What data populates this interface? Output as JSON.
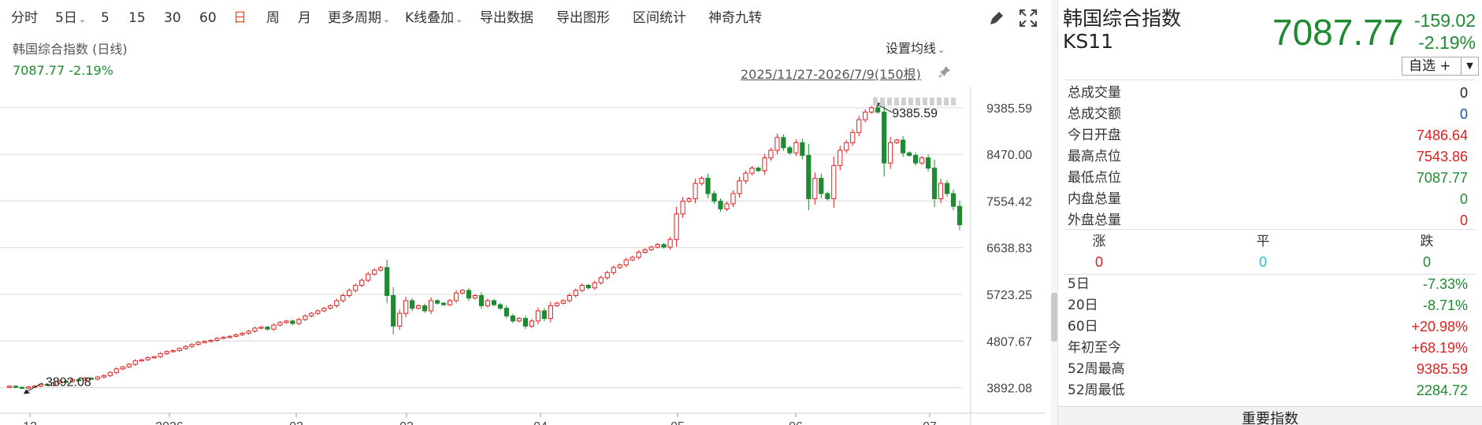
{
  "toolbar": {
    "items": [
      {
        "label": "分时",
        "dropdown": false,
        "active": false
      },
      {
        "label": "5日",
        "dropdown": true,
        "active": false
      },
      {
        "label": "5",
        "dropdown": false,
        "active": false
      },
      {
        "label": "15",
        "dropdown": false,
        "active": false
      },
      {
        "label": "30",
        "dropdown": false,
        "active": false
      },
      {
        "label": "60",
        "dropdown": false,
        "active": false
      },
      {
        "label": "日",
        "dropdown": false,
        "active": true
      },
      {
        "label": "周",
        "dropdown": false,
        "active": false
      },
      {
        "label": "月",
        "dropdown": false,
        "active": false
      },
      {
        "label": "更多周期",
        "dropdown": true,
        "active": false
      },
      {
        "label": "K线叠加",
        "dropdown": true,
        "active": false
      },
      {
        "label": "导出数据",
        "dropdown": false,
        "active": false
      },
      {
        "label": "导出图形",
        "dropdown": false,
        "active": false
      },
      {
        "label": "区间统计",
        "dropdown": false,
        "active": false
      },
      {
        "label": "神奇九转",
        "dropdown": false,
        "active": false
      }
    ],
    "icons": [
      "brush-icon",
      "fullscreen-icon"
    ],
    "caret": "⌄"
  },
  "chart_header": {
    "index_label": "韩国综合指数 (日线)",
    "value_line": "7087.77 -2.19%",
    "ma_setting": "设置均线",
    "date_range": "2025/11/27-2026/7/9(150根)"
  },
  "chart_data": {
    "type": "candlestick",
    "period": "daily",
    "ylim": [
      3700,
      9800
    ],
    "y_ticks": [
      "9385.59",
      "8470.00",
      "7554.42",
      "6638.83",
      "5723.25",
      "4807.67",
      "3892.08"
    ],
    "x_ticks": [
      "12",
      "2026",
      "02",
      "03",
      "04",
      "05",
      "06",
      "07"
    ],
    "annotations": [
      {
        "text": "9385.59",
        "kind": "high"
      },
      {
        "text": "3892.08",
        "kind": "low"
      }
    ],
    "colors": {
      "up": "#e02020",
      "down": "#1e8b32",
      "grid": "#d9d9d9"
    },
    "closes": [
      3920,
      3900,
      3892,
      3905,
      3925,
      3960,
      3940,
      3985,
      4020,
      4010,
      4050,
      4040,
      4080,
      4060,
      4100,
      4130,
      4190,
      4260,
      4300,
      4350,
      4420,
      4440,
      4480,
      4500,
      4560,
      4600,
      4620,
      4660,
      4700,
      4740,
      4780,
      4800,
      4820,
      4860,
      4880,
      4900,
      4930,
      4960,
      5000,
      5060,
      5080,
      5040,
      5120,
      5170,
      5200,
      5150,
      5230,
      5300,
      5350,
      5400,
      5450,
      5500,
      5600,
      5700,
      5800,
      5900,
      6000,
      6120,
      6200,
      6250,
      5700,
      5100,
      5350,
      5600,
      5450,
      5500,
      5400,
      5600,
      5550,
      5520,
      5600,
      5750,
      5800,
      5650,
      5700,
      5500,
      5600,
      5520,
      5450,
      5300,
      5200,
      5250,
      5100,
      5200,
      5400,
      5250,
      5500,
      5550,
      5600,
      5700,
      5800,
      5900,
      5850,
      5950,
      6050,
      6150,
      6250,
      6300,
      6400,
      6450,
      6550,
      6600,
      6650,
      6700,
      6650,
      6800,
      7300,
      7550,
      7600,
      7900,
      8000,
      7700,
      7550,
      7400,
      7500,
      7700,
      7950,
      8100,
      8200,
      8150,
      8400,
      8550,
      8800,
      8600,
      8500,
      8700,
      8450,
      7600,
      8000,
      7700,
      7600,
      8250,
      8550,
      8700,
      8900,
      9150,
      9300,
      9385,
      9300,
      8300,
      8700,
      8750,
      8500,
      8450,
      8300,
      8400,
      8200,
      7600,
      7900,
      7700,
      7450,
      7087.77
    ]
  },
  "quote": {
    "name": "韩国综合指数",
    "code": "KS11",
    "price": "7087.77",
    "change": "-159.02",
    "change_pct": "-2.19%",
    "watch_label": "自选 +",
    "watch_arrow": "▼",
    "stats": [
      {
        "label": "总成交量",
        "value": "0",
        "color": "#222222"
      },
      {
        "label": "总成交额",
        "value": "0",
        "color": "#1f4fa8"
      },
      {
        "label": "今日开盘",
        "value": "7486.64",
        "color": "#e02020"
      },
      {
        "label": "最高点位",
        "value": "7543.86",
        "color": "#e02020"
      },
      {
        "label": "最低点位",
        "value": "7087.77",
        "color": "#1e8b32"
      },
      {
        "label": "内盘总量",
        "value": "0",
        "color": "#1e8b32"
      },
      {
        "label": "外盘总量",
        "value": "0",
        "color": "#e02020"
      }
    ],
    "advance": [
      {
        "label": "涨",
        "value": "0",
        "color": "#e02020"
      },
      {
        "label": "平",
        "value": "0",
        "color": "#1ec8d8"
      },
      {
        "label": "跌",
        "value": "0",
        "color": "#1e8b32"
      }
    ],
    "performance": [
      {
        "label": "5日",
        "value": "-7.33%",
        "color": "#1e8b32"
      },
      {
        "label": "20日",
        "value": "-8.71%",
        "color": "#1e8b32"
      },
      {
        "label": "60日",
        "value": "+20.98%",
        "color": "#e02020"
      },
      {
        "label": "年初至今",
        "value": "+68.19%",
        "color": "#e02020"
      },
      {
        "label": "52周最高",
        "value": "9385.59",
        "color": "#e02020"
      },
      {
        "label": "52周最低",
        "value": "2284.72",
        "color": "#1e8b32"
      }
    ],
    "section_title": "重要指数"
  }
}
